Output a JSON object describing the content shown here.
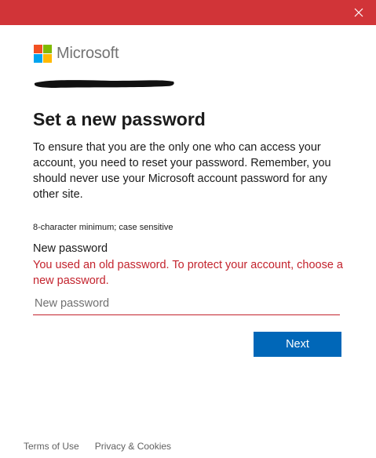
{
  "window": {
    "accent_color": "#d13438",
    "close_icon": "close-icon"
  },
  "brand": {
    "name": "Microsoft",
    "logo_colors": [
      "#f25022",
      "#7fba00",
      "#00a4ef",
      "#ffb900"
    ]
  },
  "account": {
    "identifier_redacted": true
  },
  "page": {
    "title": "Set a new password",
    "description": "To ensure that you are the only one who can access your account, you need to reset your password. Remember, you should never use your Microsoft account password for any other site.",
    "hint": "8-character minimum; case sensitive"
  },
  "form": {
    "field_label": "New password",
    "error_message": "You used an old password. To protect your account, choose a new password.",
    "error_color": "#c3232d",
    "input_value": "",
    "input_placeholder": "New password",
    "submit_label": "Next",
    "submit_color": "#0067b8"
  },
  "footer": {
    "terms_label": "Terms of Use",
    "privacy_label": "Privacy & Cookies"
  }
}
